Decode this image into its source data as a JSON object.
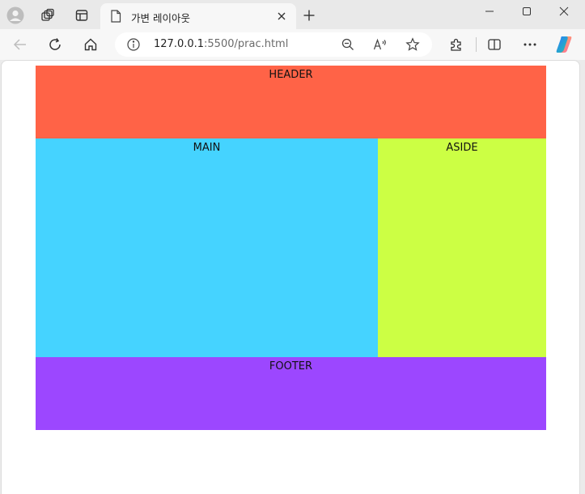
{
  "browser": {
    "tab": {
      "title": "가변 레이아웃"
    },
    "address": {
      "url_host": "127.0.0.1",
      "url_rest": ":5500/prac.html"
    }
  },
  "page": {
    "header_label": "HEADER",
    "main_label": "MAIN",
    "aside_label": "ASIDE",
    "footer_label": "FOOTER"
  },
  "colors": {
    "header": "#ff6347",
    "main": "#45d3ff",
    "aside": "#ccff44",
    "footer": "#9c47ff"
  }
}
